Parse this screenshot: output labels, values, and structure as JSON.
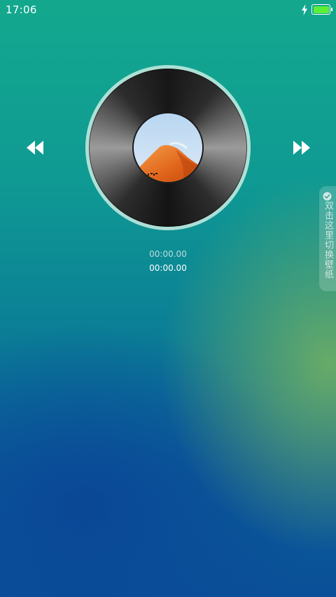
{
  "status_bar": {
    "time": "17:06",
    "charging": true,
    "battery_level": 1.0,
    "battery_color": "#5bef38"
  },
  "player": {
    "elapsed": "00:00.00",
    "total": "00:00.00",
    "prev_icon": "rewind-icon",
    "next_icon": "fast-forward-icon",
    "album_art": "desert-dune-image"
  },
  "wallpaper_tab": {
    "label": "双击这里切换壁纸",
    "icon": "check-circle-icon"
  }
}
